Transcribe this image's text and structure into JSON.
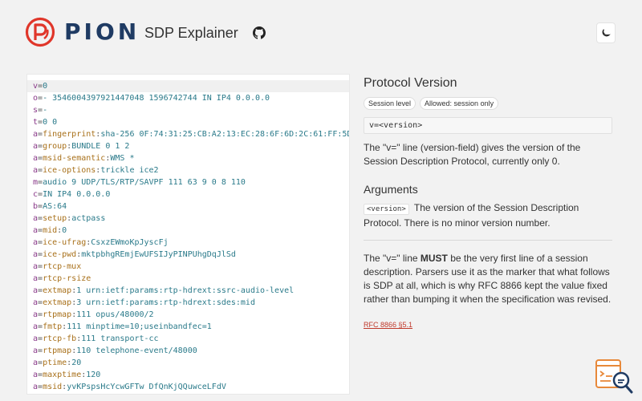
{
  "header": {
    "brand": "PION",
    "app_title": "SDP Explainer"
  },
  "colors": {
    "brand_red": "#e0362a",
    "brand_navy": "#1f3b63",
    "link": "#c0392b"
  },
  "sdp_lines": [
    {
      "type": "v",
      "attr": "",
      "value": "0",
      "active": true
    },
    {
      "type": "o",
      "attr": "",
      "value": "- 3546004397921447048 1596742744 IN IP4 0.0.0.0"
    },
    {
      "type": "s",
      "attr": "",
      "value": "-"
    },
    {
      "type": "t",
      "attr": "",
      "value": "0 0"
    },
    {
      "type": "a",
      "attr": "fingerprint",
      "value": "sha-256 0F:74:31:25:CB:A2:13:EC:28:6F:6D:2C:61:FF:5D"
    },
    {
      "type": "a",
      "attr": "group",
      "value": "BUNDLE 0 1 2"
    },
    {
      "type": "a",
      "attr": "msid-semantic",
      "value": "WMS *"
    },
    {
      "type": "a",
      "attr": "ice-options",
      "value": "trickle ice2"
    },
    {
      "type": "m",
      "attr": "",
      "value": "audio 9 UDP/TLS/RTP/SAVPF 111 63 9 0 8 110"
    },
    {
      "type": "c",
      "attr": "",
      "value": "IN IP4 0.0.0.0"
    },
    {
      "type": "b",
      "attr": "",
      "value": "AS:64"
    },
    {
      "type": "a",
      "attr": "setup",
      "value": "actpass"
    },
    {
      "type": "a",
      "attr": "mid",
      "value": "0"
    },
    {
      "type": "a",
      "attr": "ice-ufrag",
      "value": "CsxzEWmoKpJyscFj"
    },
    {
      "type": "a",
      "attr": "ice-pwd",
      "value": "mktpbhgREmjEwUFSIJyPINPUhgDqJlSd"
    },
    {
      "type": "a",
      "attr": "rtcp-mux",
      "value": ""
    },
    {
      "type": "a",
      "attr": "rtcp-rsize",
      "value": ""
    },
    {
      "type": "a",
      "attr": "extmap",
      "value": "1 urn:ietf:params:rtp-hdrext:ssrc-audio-level"
    },
    {
      "type": "a",
      "attr": "extmap",
      "value": "3 urn:ietf:params:rtp-hdrext:sdes:mid"
    },
    {
      "type": "a",
      "attr": "rtpmap",
      "value": "111 opus/48000/2"
    },
    {
      "type": "a",
      "attr": "fmtp",
      "value": "111 minptime=10;useinbandfec=1"
    },
    {
      "type": "a",
      "attr": "rtcp-fb",
      "value": "111 transport-cc"
    },
    {
      "type": "a",
      "attr": "rtpmap",
      "value": "110 telephone-event/48000"
    },
    {
      "type": "a",
      "attr": "ptime",
      "value": "20"
    },
    {
      "type": "a",
      "attr": "maxptime",
      "value": "120"
    },
    {
      "type": "a",
      "attr": "msid",
      "value": "yvKPspsHcYcwGFTw DfQnKjQQuwceLFdV"
    }
  ],
  "detail": {
    "title": "Protocol Version",
    "badges": [
      "Session level",
      "Allowed: session only"
    ],
    "syntax": "v=<version>",
    "description": "The \"v=\" line (version-field) gives the version of the Session Description Protocol, currently only 0.",
    "arguments_title": "Arguments",
    "argument": {
      "name": "<version>",
      "description": "The version of the Session Description Protocol. There is no minor version number."
    },
    "note_before": "The \"v=\" line ",
    "note_strong": "MUST",
    "note_after": " be the very first line of a session description. Parsers use it as the marker that what follows is SDP at all, which is why RFC 8866 kept the value fixed rather than bumping it when the specification was revised.",
    "reference": "RFC 8866 §5.1"
  }
}
